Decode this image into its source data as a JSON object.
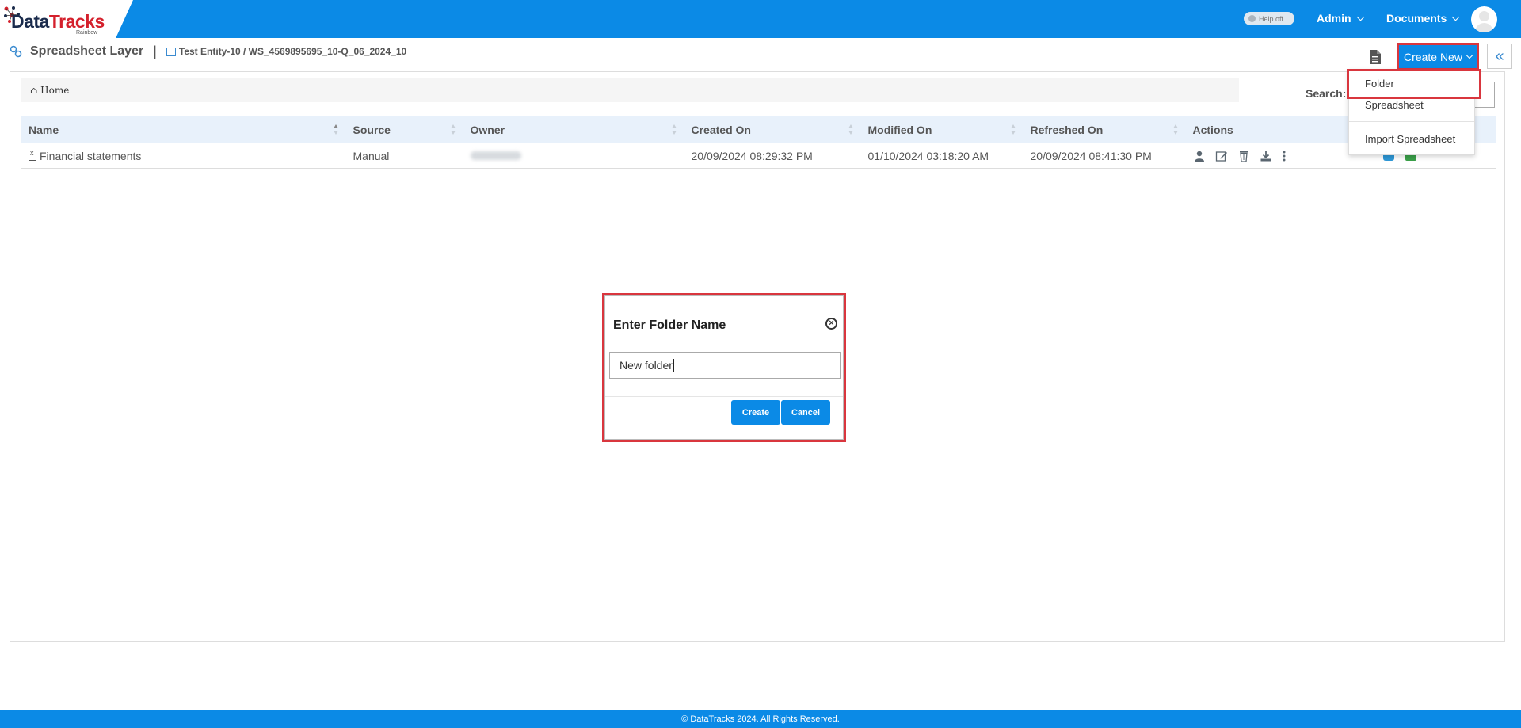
{
  "app": {
    "logo_part1": "Data",
    "logo_part2": "Tracks",
    "logo_sub": "Rainbow",
    "help_toggle": "Help off",
    "nav": {
      "admin": "Admin",
      "documents": "Documents"
    }
  },
  "page": {
    "title": "Spreadsheet Layer",
    "separator": "|",
    "path": "Test Entity-10 / WS_4569895695_10-Q_06_2024_10"
  },
  "toolbar": {
    "create_new": "Create New",
    "collapse": "«"
  },
  "create_menu": {
    "items": [
      "Folder",
      "Spreadsheet",
      "Import Spreadsheet"
    ]
  },
  "breadcrumb": {
    "home": "Home"
  },
  "search": {
    "label": "Search:",
    "value": ""
  },
  "table": {
    "columns": [
      "Name",
      "Source",
      "Owner",
      "Created On",
      "Modified On",
      "Refreshed On",
      "Actions"
    ],
    "rows": [
      {
        "name": "Financial statements",
        "source": "Manual",
        "owner": "",
        "created_on": "20/09/2024 08:29:32 PM",
        "modified_on": "01/10/2024 03:18:20 AM",
        "refreshed_on": "20/09/2024 08:41:30 PM"
      }
    ]
  },
  "modal": {
    "title": "Enter Folder Name",
    "input_value": "New folder",
    "create_label": "Create",
    "cancel_label": "Cancel"
  },
  "footer": {
    "text": "© DataTracks 2024. All Rights Reserved."
  },
  "colors": {
    "brand_blue": "#0b8ae6",
    "highlight_red": "#d9363e"
  }
}
